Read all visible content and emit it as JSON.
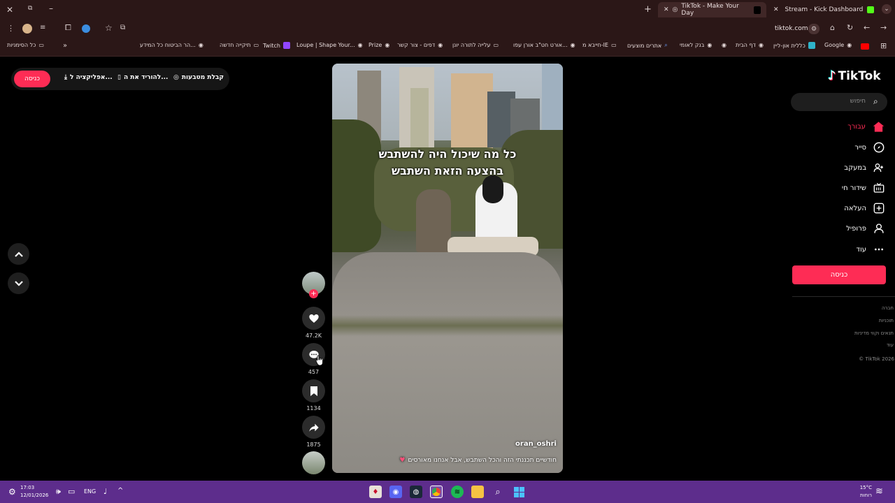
{
  "browser": {
    "tabs": [
      {
        "label": "TikTok - Make Your Day",
        "active": true
      },
      {
        "label": "Stream - Kick Dashboard",
        "active": false
      }
    ],
    "new_tab_symbol": "+",
    "address": "tiktok.com",
    "bookmarks": [
      {
        "label": "כל הסימניות",
        "icon": "folder-icon"
      },
      {
        "label": "הר הביטוח כל המידע...",
        "icon": "globe-icon"
      },
      {
        "label": "תיקייה חדשה",
        "icon": "folder-icon"
      },
      {
        "label": "Twitch",
        "icon": "twitch-icon"
      },
      {
        "label": "Loupe | Shape Your...",
        "icon": "globe-icon"
      },
      {
        "label": "Prize",
        "icon": "globe-icon"
      },
      {
        "label": "דפים - צור קשר",
        "icon": "globe-icon"
      },
      {
        "label": "עלייה לתורה יונן",
        "icon": "folder-icon"
      },
      {
        "label": "אורט חט\"ב אורן עפו...",
        "icon": "globe-icon"
      },
      {
        "label": "חייבא מ-IE",
        "icon": "folder-icon"
      },
      {
        "label": "אתרים מוצעים",
        "icon": "search-icon"
      },
      {
        "label": "בנק לאומי",
        "icon": "globe-icon"
      },
      {
        "label": "דף הבית",
        "icon": "globe-icon"
      },
      {
        "label": "כללית און-ליין",
        "icon": "clalit-icon"
      },
      {
        "label": "Google",
        "icon": "globe-icon"
      }
    ]
  },
  "tiktok": {
    "logo_text": "TikTok",
    "search_placeholder": "חיפוש",
    "login_label": "כניסה",
    "nav": [
      {
        "label": "עבורך",
        "icon": "home-icon",
        "active": true
      },
      {
        "label": "סייר",
        "icon": "compass-icon",
        "active": false
      },
      {
        "label": "במעקב",
        "icon": "following-icon",
        "active": false
      },
      {
        "label": "שידור חי",
        "icon": "live-icon",
        "active": false
      },
      {
        "label": "העלאה",
        "icon": "upload-icon",
        "active": false
      },
      {
        "label": "פרופיל",
        "icon": "profile-icon",
        "active": false
      },
      {
        "label": "עוד",
        "icon": "more-icon",
        "active": false
      }
    ],
    "footer": [
      "חברה",
      "תוכניות",
      "תנאים וקווי מדיניות",
      "עוד",
      "TikTok 2026 ©"
    ],
    "top_links": {
      "coins": "קבלת מטבעות",
      "download": "להוריד את ה...",
      "app": "אפליקציה ל...",
      "login": "כניסה"
    },
    "video": {
      "caption_line1": "כל מה שיכול היה להשתבש",
      "caption_line2": "בהצעה הזאת השתבש",
      "username": "oran_oshri",
      "description": "חודשיים תכננתי הזה והכל השתבש, אבל אנחנו מאורסים"
    },
    "actions": {
      "likes": "47.2K",
      "comments": "457",
      "saves": "1134",
      "shares": "1875"
    }
  },
  "taskbar": {
    "time": "17:03",
    "date": "12/01/2026",
    "lang": "ENG",
    "weather_temp": "15°C",
    "weather_desc": "רוחות"
  }
}
